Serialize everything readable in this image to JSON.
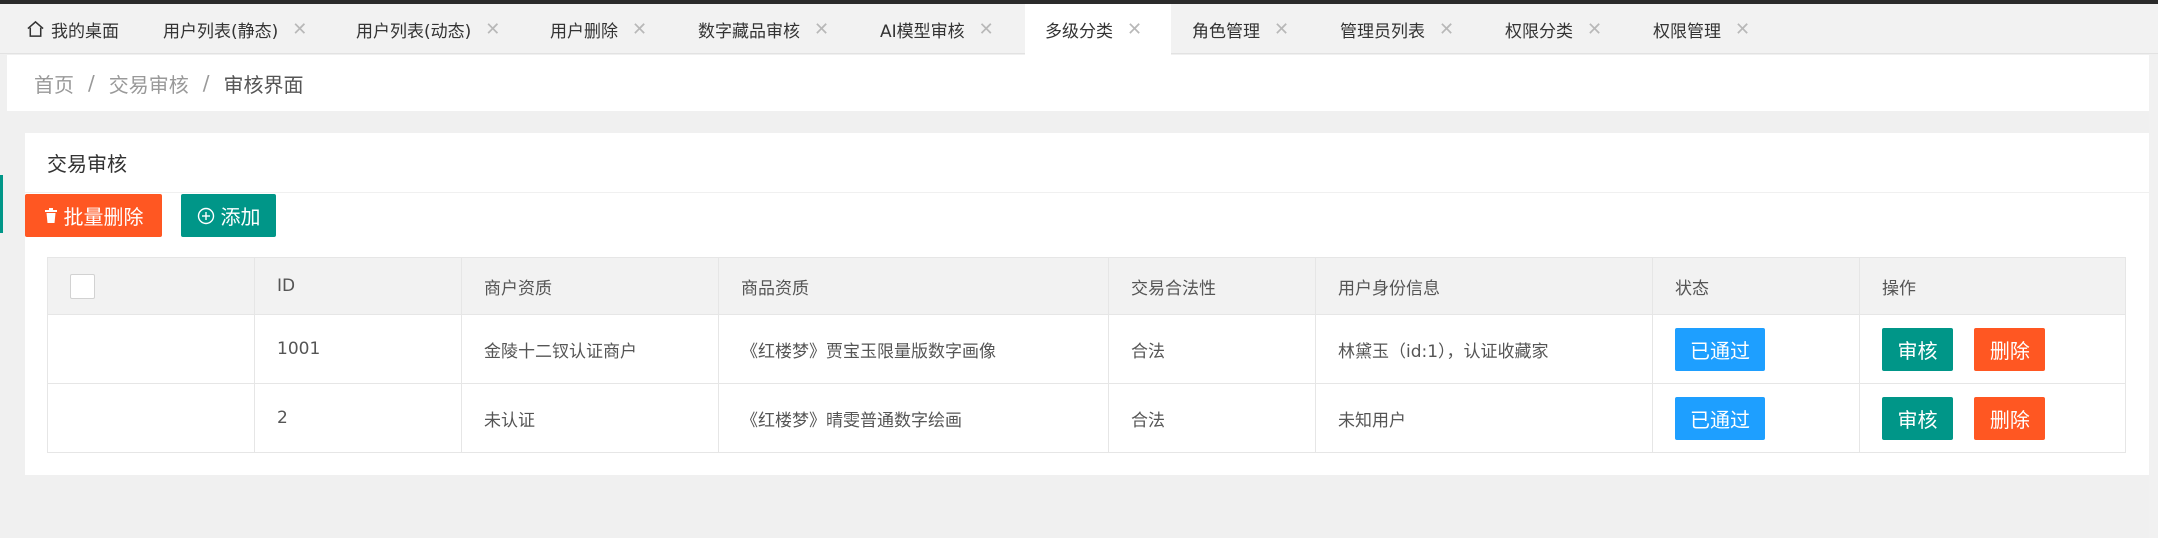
{
  "tabs": [
    {
      "label": "我的桌面",
      "icon": "home-icon",
      "closable": false,
      "active": false
    },
    {
      "label": "用户列表(静态)",
      "closable": true,
      "active": false
    },
    {
      "label": "用户列表(动态)",
      "closable": true,
      "active": false
    },
    {
      "label": "用户删除",
      "closable": true,
      "active": false
    },
    {
      "label": "数字藏品审核",
      "closable": true,
      "active": false
    },
    {
      "label": "AI模型审核",
      "closable": true,
      "active": false
    },
    {
      "label": "多级分类",
      "closable": true,
      "active": true
    },
    {
      "label": "角色管理",
      "closable": true,
      "active": false
    },
    {
      "label": "管理员列表",
      "closable": true,
      "active": false
    },
    {
      "label": "权限分类",
      "closable": true,
      "active": false
    },
    {
      "label": "权限管理",
      "closable": true,
      "active": false
    }
  ],
  "close_glyph": "✕",
  "breadcrumb": {
    "items": [
      "首页",
      "交易审核",
      "审核界面"
    ],
    "separator": "/"
  },
  "card": {
    "title": "交易审核"
  },
  "toolbar": {
    "batch_delete_label": "批量删除",
    "add_label": "添加"
  },
  "table": {
    "headers": [
      "",
      "ID",
      "商户资质",
      "商品资质",
      "交易合法性",
      "用户身份信息",
      "状态",
      "操作"
    ],
    "rows": [
      {
        "id": "1001",
        "merchant": "金陵十二钗认证商户",
        "product": "《红楼梦》贾宝玉限量版数字画像",
        "legality": "合法",
        "identity": "林黛玉（id:1），认证收藏家",
        "status": "已通过",
        "review_label": "审核",
        "delete_label": "删除"
      },
      {
        "id": "2",
        "merchant": "未认证",
        "product": "《红楼梦》晴雯普通数字绘画",
        "legality": "合法",
        "identity": "未知用户",
        "status": "已通过",
        "review_label": "审核",
        "delete_label": "删除"
      }
    ]
  },
  "colors": {
    "primary": "#009688",
    "danger": "#ff5722",
    "info": "#1e9fff"
  }
}
